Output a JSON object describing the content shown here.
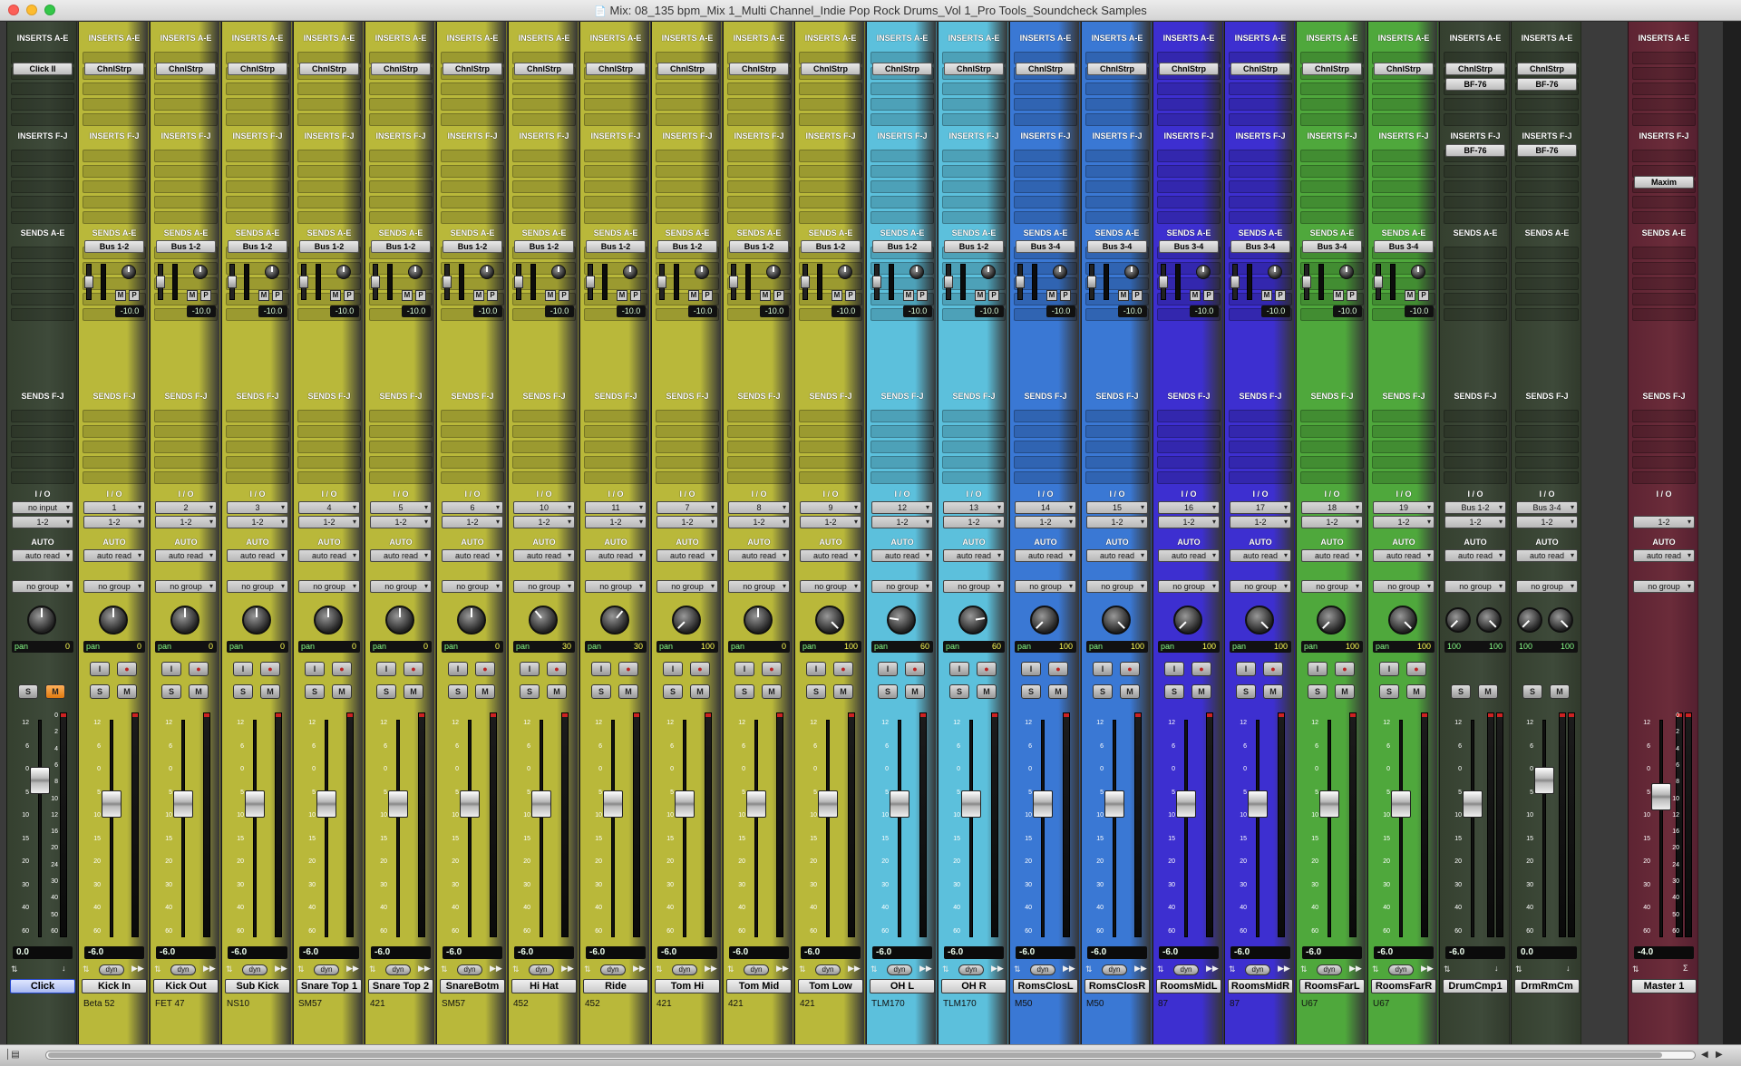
{
  "window": {
    "title": "Mix: 08_135 bpm_Mix 1_Multi Channel_Indie Pop Rock Drums_Vol 1_Pro Tools_Soundcheck Samples",
    "controls": [
      "close",
      "minimize",
      "zoom"
    ]
  },
  "section_labels": {
    "inserts_ae": "INSERTS A-E",
    "inserts_fj": "INSERTS F-J",
    "sends_ae": "SENDS A-E",
    "sends_fj": "SENDS F-J",
    "io": "I / O",
    "auto": "AUTO",
    "pan": "pan",
    "record": "I",
    "solo": "S",
    "mute": "M",
    "send_mute": "M",
    "send_pre": "P",
    "dyn": "dyn"
  },
  "colors": {
    "system": "#3e4a3a",
    "drums": "#b9b83a",
    "overhead": "#5cc0dc",
    "close_room": "#3a78d4",
    "mid_room": "#3d2fd0",
    "far_room": "#4fa83c",
    "aux": "#3e4a3a",
    "master": "#6b2c3a"
  },
  "strips": [
    {
      "name": "Click",
      "comment": "",
      "color": "system",
      "plugins_ae": [
        "Click II"
      ],
      "plugins_fj": [],
      "send": "",
      "send_level": "",
      "input": "no input",
      "output": "1-2",
      "auto": "auto read",
      "group": "no group",
      "pan": "0",
      "volume": "0.0",
      "mute_active": true,
      "type": "click"
    },
    {
      "name": "Kick In",
      "comment": "Beta 52",
      "color": "drums",
      "plugins_ae": [
        "ChnlStrp"
      ],
      "plugins_fj": [],
      "send": "Bus 1-2",
      "send_level": "-10.0",
      "input": "1",
      "output": "1-2",
      "auto": "auto read",
      "group": "no group",
      "pan": "0",
      "volume": "-6.0"
    },
    {
      "name": "Kick Out",
      "comment": "FET 47",
      "color": "drums",
      "plugins_ae": [
        "ChnlStrp"
      ],
      "plugins_fj": [],
      "send": "Bus 1-2",
      "send_level": "-10.0",
      "input": "2",
      "output": "1-2",
      "auto": "auto read",
      "group": "no group",
      "pan": "0",
      "volume": "-6.0"
    },
    {
      "name": "Sub Kick",
      "comment": "NS10",
      "color": "drums",
      "plugins_ae": [
        "ChnlStrp"
      ],
      "plugins_fj": [],
      "send": "Bus 1-2",
      "send_level": "-10.0",
      "input": "3",
      "output": "1-2",
      "auto": "auto read",
      "group": "no group",
      "pan": "0",
      "volume": "-6.0"
    },
    {
      "name": "Snare Top 1",
      "comment": "SM57",
      "color": "drums",
      "plugins_ae": [
        "ChnlStrp"
      ],
      "plugins_fj": [],
      "send": "Bus 1-2",
      "send_level": "-10.0",
      "input": "4",
      "output": "1-2",
      "auto": "auto read",
      "group": "no group",
      "pan": "0",
      "volume": "-6.0"
    },
    {
      "name": "Snare Top 2",
      "comment": "421",
      "color": "drums",
      "plugins_ae": [
        "ChnlStrp"
      ],
      "plugins_fj": [],
      "send": "Bus 1-2",
      "send_level": "-10.0",
      "input": "5",
      "output": "1-2",
      "auto": "auto read",
      "group": "no group",
      "pan": "0",
      "volume": "-6.0"
    },
    {
      "name": "SnareBotm",
      "comment": "SM57",
      "color": "drums",
      "plugins_ae": [
        "ChnlStrp"
      ],
      "plugins_fj": [],
      "send": "Bus 1-2",
      "send_level": "-10.0",
      "input": "6",
      "output": "1-2",
      "auto": "auto read",
      "group": "no group",
      "pan": "0",
      "volume": "-6.0"
    },
    {
      "name": "Hi Hat",
      "comment": "452",
      "color": "drums",
      "plugins_ae": [
        "ChnlStrp"
      ],
      "plugins_fj": [],
      "send": "Bus 1-2",
      "send_level": "-10.0",
      "input": "10",
      "output": "1-2",
      "auto": "auto read",
      "group": "no group",
      "pan": "30",
      "pan_dir": "left",
      "volume": "-6.0"
    },
    {
      "name": "Ride",
      "comment": "452",
      "color": "drums",
      "plugins_ae": [
        "ChnlStrp"
      ],
      "plugins_fj": [],
      "send": "Bus 1-2",
      "send_level": "-10.0",
      "input": "11",
      "output": "1-2",
      "auto": "auto read",
      "group": "no group",
      "pan": "30",
      "pan_dir": "right",
      "volume": "-6.0"
    },
    {
      "name": "Tom Hi",
      "comment": "421",
      "color": "drums",
      "plugins_ae": [
        "ChnlStrp"
      ],
      "plugins_fj": [],
      "send": "Bus 1-2",
      "send_level": "-10.0",
      "input": "7",
      "output": "1-2",
      "auto": "auto read",
      "group": "no group",
      "pan": "100",
      "pan_dir": "left",
      "volume": "-6.0"
    },
    {
      "name": "Tom Mid",
      "comment": "421",
      "color": "drums",
      "plugins_ae": [
        "ChnlStrp"
      ],
      "plugins_fj": [],
      "send": "Bus 1-2",
      "send_level": "-10.0",
      "input": "8",
      "output": "1-2",
      "auto": "auto read",
      "group": "no group",
      "pan": "0",
      "volume": "-6.0"
    },
    {
      "name": "Tom Low",
      "comment": "421",
      "color": "drums",
      "plugins_ae": [
        "ChnlStrp"
      ],
      "plugins_fj": [],
      "send": "Bus 1-2",
      "send_level": "-10.0",
      "input": "9",
      "output": "1-2",
      "auto": "auto read",
      "group": "no group",
      "pan": "100",
      "pan_dir": "right",
      "volume": "-6.0"
    },
    {
      "name": "OH L",
      "comment": "TLM170",
      "color": "overhead",
      "plugins_ae": [
        "ChnlStrp"
      ],
      "plugins_fj": [],
      "send": "Bus 1-2",
      "send_level": "-10.0",
      "input": "12",
      "output": "1-2",
      "auto": "auto read",
      "group": "no group",
      "pan": "60",
      "pan_dir": "left",
      "volume": "-6.0"
    },
    {
      "name": "OH R",
      "comment": "TLM170",
      "color": "overhead",
      "plugins_ae": [
        "ChnlStrp"
      ],
      "plugins_fj": [],
      "send": "Bus 1-2",
      "send_level": "-10.0",
      "input": "13",
      "output": "1-2",
      "auto": "auto read",
      "group": "no group",
      "pan": "60",
      "pan_dir": "right",
      "volume": "-6.0"
    },
    {
      "name": "RomsClosL",
      "comment": "M50",
      "color": "close_room",
      "plugins_ae": [
        "ChnlStrp"
      ],
      "plugins_fj": [],
      "send": "Bus 3-4",
      "send_level": "-10.0",
      "input": "14",
      "output": "1-2",
      "auto": "auto read",
      "group": "no group",
      "pan": "100",
      "pan_dir": "left",
      "volume": "-6.0"
    },
    {
      "name": "RomsClosR",
      "comment": "M50",
      "color": "close_room",
      "plugins_ae": [
        "ChnlStrp"
      ],
      "plugins_fj": [],
      "send": "Bus 3-4",
      "send_level": "-10.0",
      "input": "15",
      "output": "1-2",
      "auto": "auto read",
      "group": "no group",
      "pan": "100",
      "pan_dir": "right",
      "volume": "-6.0"
    },
    {
      "name": "RoomsMidL",
      "comment": "87",
      "color": "mid_room",
      "plugins_ae": [
        "ChnlStrp"
      ],
      "plugins_fj": [],
      "send": "Bus 3-4",
      "send_level": "-10.0",
      "input": "16",
      "output": "1-2",
      "auto": "auto read",
      "group": "no group",
      "pan": "100",
      "pan_dir": "left",
      "volume": "-6.0"
    },
    {
      "name": "RoomsMidR",
      "comment": "87",
      "color": "mid_room",
      "plugins_ae": [
        "ChnlStrp"
      ],
      "plugins_fj": [],
      "send": "Bus 3-4",
      "send_level": "-10.0",
      "input": "17",
      "output": "1-2",
      "auto": "auto read",
      "group": "no group",
      "pan": "100",
      "pan_dir": "right",
      "volume": "-6.0"
    },
    {
      "name": "RoomsFarL",
      "comment": "U67",
      "color": "far_room",
      "plugins_ae": [
        "ChnlStrp"
      ],
      "plugins_fj": [],
      "send": "Bus 3-4",
      "send_level": "-10.0",
      "input": "18",
      "output": "1-2",
      "auto": "auto read",
      "group": "no group",
      "pan": "100",
      "pan_dir": "left",
      "volume": "-6.0"
    },
    {
      "name": "RoomsFarR",
      "comment": "U67",
      "color": "far_room",
      "plugins_ae": [
        "ChnlStrp"
      ],
      "plugins_fj": [],
      "send": "Bus 3-4",
      "send_level": "-10.0",
      "input": "19",
      "output": "1-2",
      "auto": "auto read",
      "group": "no group",
      "pan": "100",
      "pan_dir": "right",
      "volume": "-6.0"
    },
    {
      "name": "DrumCmp1",
      "comment": "",
      "color": "aux",
      "plugins_ae": [
        "ChnlStrp",
        "BF-76"
      ],
      "plugins_fj": [
        "BF-76"
      ],
      "send": "",
      "send_level": "",
      "input": "Bus 1-2",
      "output": "1-2",
      "auto": "auto read",
      "group": "no group",
      "pan": "100",
      "pan_r": "100",
      "stereo": true,
      "volume": "-6.0",
      "type": "aux"
    },
    {
      "name": "DrmRmCm",
      "comment": "",
      "color": "aux",
      "plugins_ae": [
        "ChnlStrp",
        "BF-76"
      ],
      "plugins_fj": [
        "BF-76"
      ],
      "send": "",
      "send_level": "",
      "input": "Bus 3-4",
      "output": "1-2",
      "auto": "auto read",
      "group": "no group",
      "pan": "100",
      "pan_r": "100",
      "stereo": true,
      "volume": "0.0",
      "type": "aux"
    },
    {
      "name": "Master 1",
      "comment": "",
      "color": "master",
      "plugins_ae": [],
      "plugins_fj": [
        "Maxim"
      ],
      "send": "",
      "send_level": "",
      "input": "",
      "output": "1-2",
      "auto": "auto read",
      "group": "no group",
      "pan": "",
      "volume": "-4.0",
      "type": "master"
    }
  ],
  "scale_ticks": [
    "12",
    "6",
    "0",
    "5",
    "10",
    "15",
    "20",
    "30",
    "40",
    "60"
  ],
  "meter_ticks": [
    "0",
    "2",
    "4",
    "6",
    "8",
    "10",
    "12",
    "16",
    "20",
    "24",
    "30",
    "40",
    "50",
    "60"
  ]
}
